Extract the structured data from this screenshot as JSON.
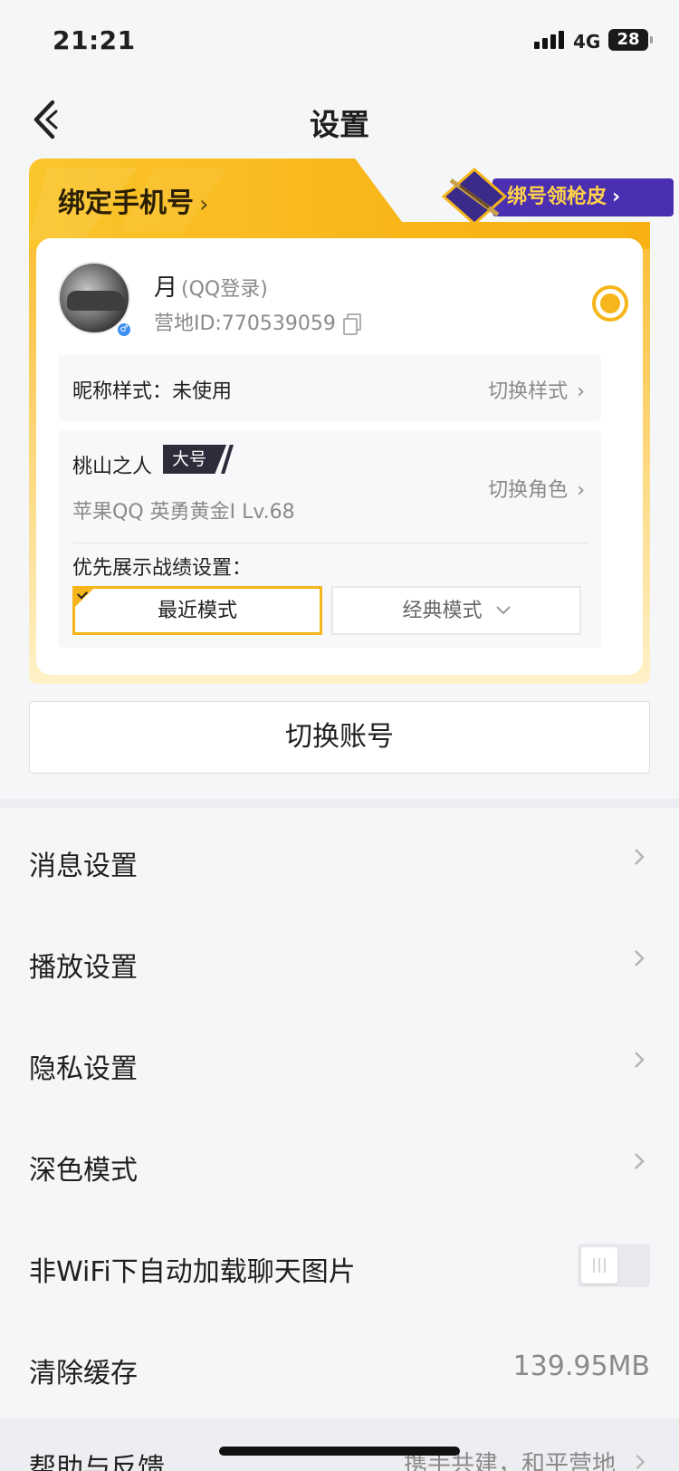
{
  "status_bar": {
    "time": "21:21",
    "network": "4G",
    "battery": "28"
  },
  "nav": {
    "title": "设置",
    "back_icon": "chevron-left-icon"
  },
  "account_card": {
    "bind_phone_label": "绑定手机号",
    "promo_label": "绑号领枪皮",
    "user": {
      "name": "月",
      "login_type": "(QQ登录)",
      "camp_id": "营地ID:770539059"
    },
    "nickname_style": {
      "label": "昵称样式：未使用",
      "action": "切换样式"
    },
    "role": {
      "name": "桃山之人",
      "badge": "大号",
      "info": "苹果QQ  英勇黄金I  Lv.68",
      "action": "切换角色"
    },
    "record_pref": {
      "label": "优先展示战绩设置：",
      "selected": "最近模式",
      "other": "经典模式"
    }
  },
  "switch_account_label": "切换账号",
  "menu": [
    {
      "label": "消息设置"
    },
    {
      "label": "播放设置"
    },
    {
      "label": "隐私设置"
    },
    {
      "label": "深色模式"
    },
    {
      "label": "非WiFi下自动加载聊天图片",
      "toggle_on": false
    },
    {
      "label": "清除缓存",
      "value": "139.95MB"
    }
  ],
  "help": {
    "label": "帮助与反馈",
    "value": "携手共建，和平营地"
  },
  "colors": {
    "accent_gold": "#f6b51a",
    "promo_purple": "#4a2fb0",
    "page_bg": "#f5f6f8"
  }
}
